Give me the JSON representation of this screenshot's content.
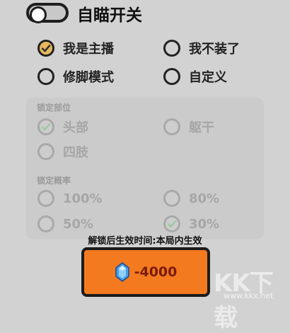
{
  "auto_aim": {
    "label": "自瞄开关",
    "enabled": false
  },
  "modes": [
    {
      "label": "我是主播",
      "checked": true
    },
    {
      "label": "我不装了",
      "checked": false
    },
    {
      "label": "修脚模式",
      "checked": false
    },
    {
      "label": "自定义",
      "checked": false
    }
  ],
  "lock_part": {
    "label": "锁定部位",
    "options": [
      {
        "label": "头部",
        "checked": true
      },
      {
        "label": "躯干",
        "checked": false
      },
      {
        "label": "四肢",
        "checked": false
      }
    ]
  },
  "lock_rate": {
    "label": "锁定概率",
    "options": [
      {
        "label": "100%",
        "checked": false
      },
      {
        "label": "80%",
        "checked": false
      },
      {
        "label": "50%",
        "checked": false
      },
      {
        "label": "30%",
        "checked": true
      }
    ]
  },
  "unlock_note": "解锁后生效时间:本局内生效",
  "cost_button": {
    "value": "-4000",
    "icon": "crystal-gem-icon"
  },
  "watermark": {
    "logo": "KK下载",
    "url": "www.kkx.net"
  },
  "colors": {
    "accent": "#f47a1f",
    "check": "#e7b95e",
    "background": "#d2d2d2"
  }
}
